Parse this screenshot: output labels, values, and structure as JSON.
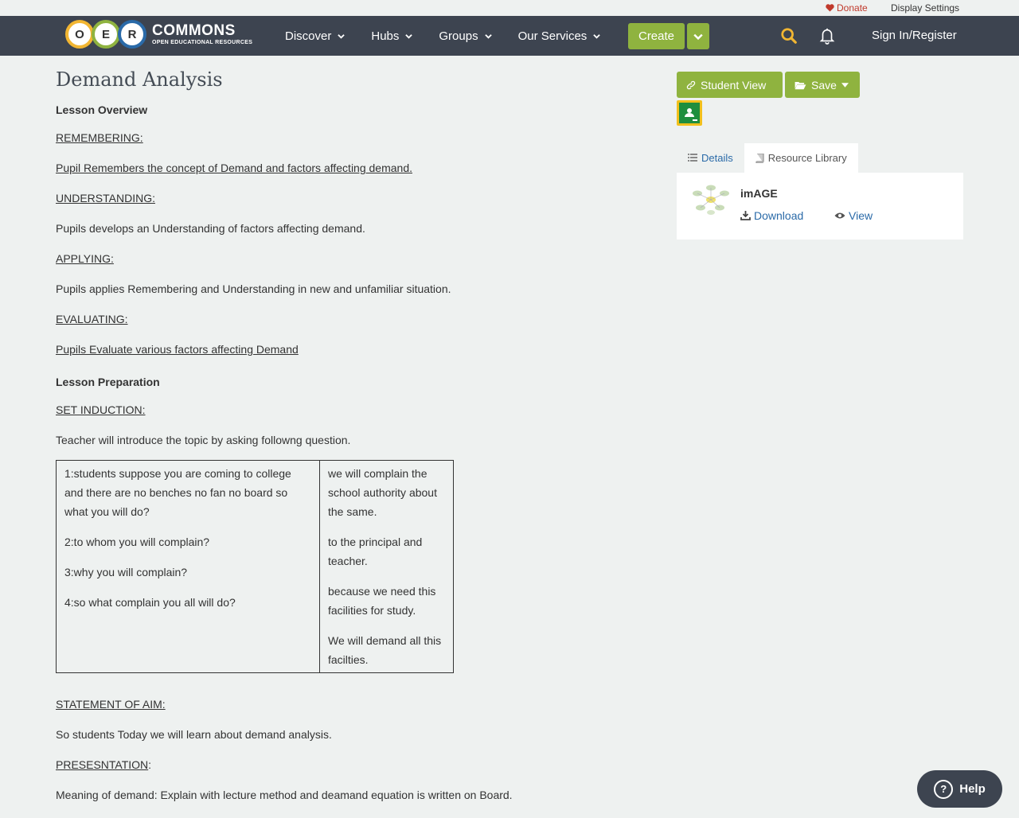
{
  "utility": {
    "donate_label": "Donate",
    "display_settings_label": "Display Settings"
  },
  "nav": {
    "logo_letters": [
      "O",
      "E",
      "R"
    ],
    "logo_colors": [
      "#f2b632",
      "#8fb33f",
      "#2a6aa8"
    ],
    "brand_title": "COMMONS",
    "brand_subtitle": "OPEN EDUCATIONAL RESOURCES",
    "menu": [
      {
        "label": "Discover"
      },
      {
        "label": "Hubs"
      },
      {
        "label": "Groups"
      },
      {
        "label": "Our Services"
      }
    ],
    "create_label": "Create",
    "signin_label": "Sign In/Register"
  },
  "content": {
    "title": "Demand Analysis",
    "overview_heading": "Lesson Overview",
    "remembering_heading": "REMEMBERING:",
    "remembering_text": "Pupil Remembers the concept of Demand and factors affecting demand.",
    "understanding_heading": "UNDERSTANDING:",
    "understanding_text": "Pupils develops an Understanding of factors affecting demand.",
    "applying_heading": "APPLYING:",
    "applying_text": "Pupils applies Remembering and Understanding in new and unfamiliar situation.",
    "evaluating_heading": "EVALUATING:",
    "evaluating_text": "Pupils Evaluate various factors affecting Demand",
    "preparation_heading": "Lesson Preparation",
    "set_induction_heading": "SET INDUCTION:",
    "set_induction_text": "Teacher will introduce the topic by asking followng question.",
    "questions": [
      "1:students suppose you are coming to college and there are no benches no fan no board so what you will do?",
      "2:to whom you will complain?",
      "3:why you will complain?",
      "4:so what complain you all will do?"
    ],
    "answers": [
      "we will complain the school authority about the same.",
      "to the principal and teacher.",
      "because we need this facilities for study.",
      "We will demand all this facilties."
    ],
    "aim_heading": "STATEMENT OF AIM:",
    "aim_text": "So students Today we will learn about demand analysis.",
    "presentation_heading": "PRESESNTATION",
    "presentation_colon": ":",
    "presentation_text": "Meaning of demand: Explain with lecture method and deamand equation is written on Board."
  },
  "sidebar": {
    "student_view_label": "Student View",
    "save_label": "Save",
    "tab_details": "Details",
    "tab_library": "Resource Library",
    "resource_title": "imAGE",
    "download_label": "Download",
    "view_label": "View"
  },
  "help_label": "Help",
  "colors": {
    "nav_bg": "#3d4450",
    "accent_green": "#8fb33f",
    "link_blue": "#2a6aa8",
    "donate_red": "#c0392b",
    "search_yellow": "#f2b632"
  }
}
